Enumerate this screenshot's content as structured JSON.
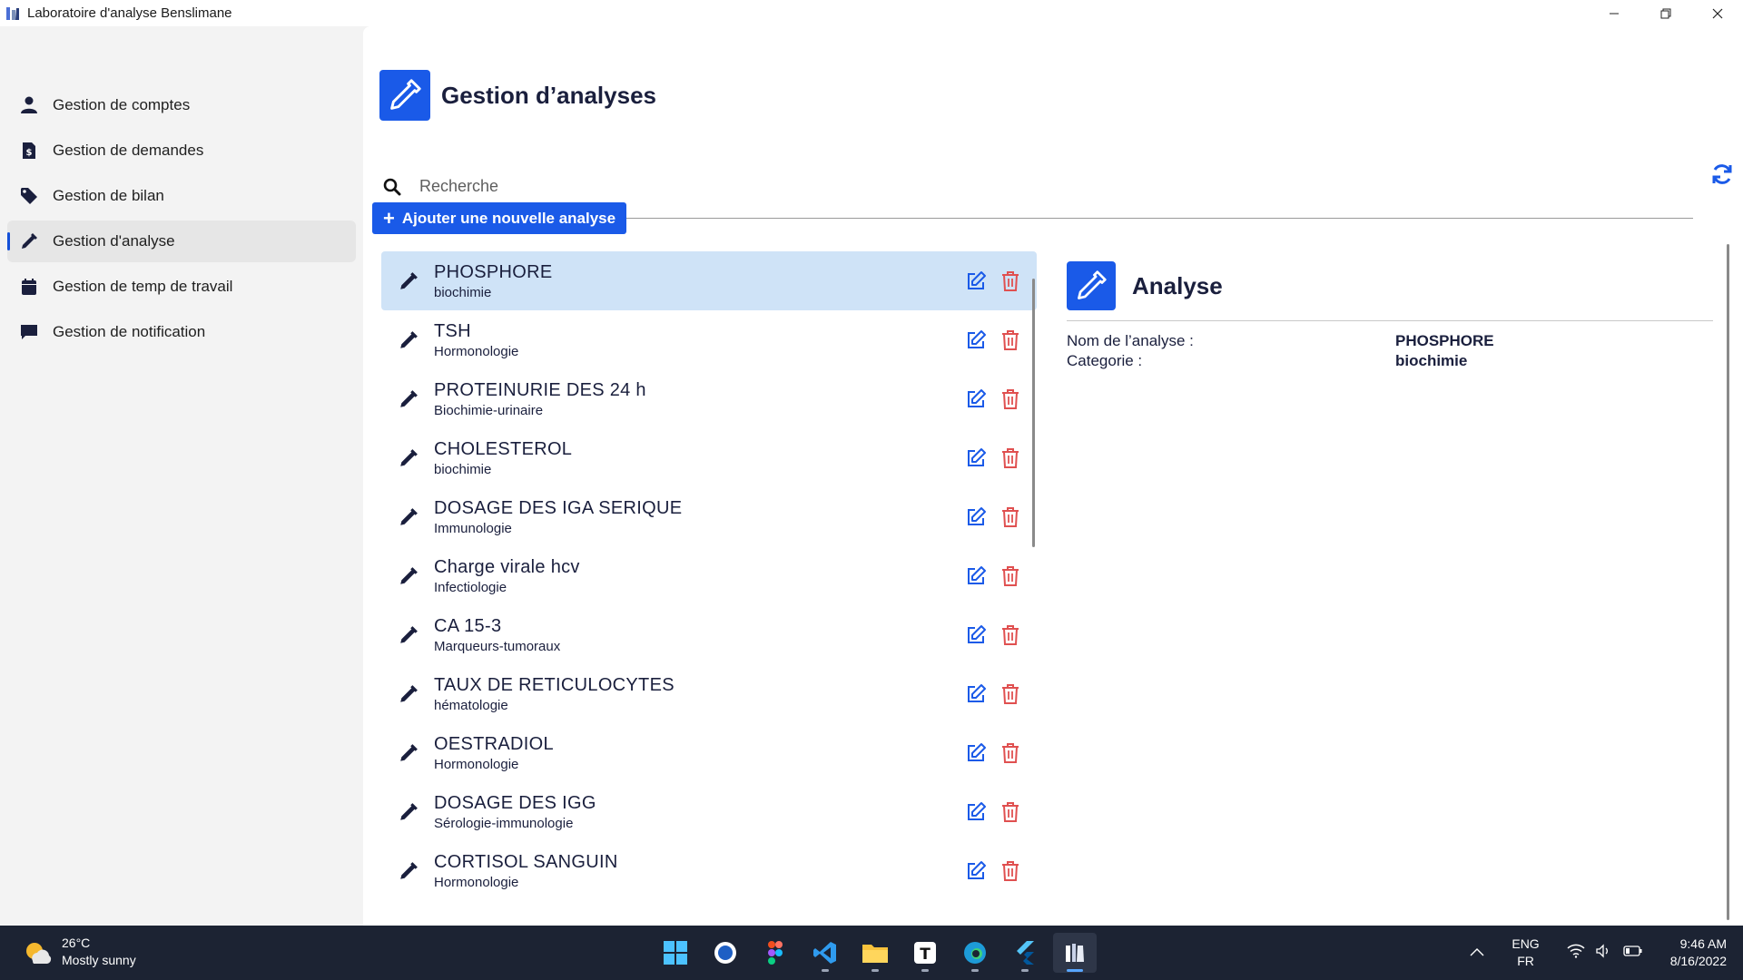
{
  "window": {
    "title": "Laboratoire d'analyse Benslimane"
  },
  "sidebar": {
    "items": [
      {
        "label": "Gestion de comptes",
        "icon": "user-icon"
      },
      {
        "label": "Gestion de demandes",
        "icon": "invoice-icon"
      },
      {
        "label": "Gestion de bilan",
        "icon": "tag-icon"
      },
      {
        "label": "Gestion d'analyse",
        "icon": "pipette-icon",
        "active": true
      },
      {
        "label": "Gestion de temp de travail",
        "icon": "calendar-icon"
      },
      {
        "label": "Gestion de notification",
        "icon": "message-icon"
      }
    ]
  },
  "header": {
    "title": "Gestion d’analyses"
  },
  "search": {
    "placeholder": "Recherche",
    "value": ""
  },
  "toolbar": {
    "add_label": "Ajouter  une nouvelle analyse"
  },
  "analyses": [
    {
      "name": "PHOSPHORE",
      "category": "biochimie"
    },
    {
      "name": "TSH",
      "category": "Hormonologie"
    },
    {
      "name": "PROTEINURIE DES 24 h",
      "category": "Biochimie-urinaire"
    },
    {
      "name": "CHOLESTEROL",
      "category": "biochimie"
    },
    {
      "name": "DOSAGE DES IGA SERIQUE",
      "category": "Immunologie"
    },
    {
      "name": "Charge virale hcv",
      "category": "Infectiologie"
    },
    {
      "name": "CA 15-3",
      "category": "Marqueurs-tumoraux"
    },
    {
      "name": "TAUX DE RETICULOCYTES",
      "category": "hématologie"
    },
    {
      "name": "OESTRADIOL",
      "category": "Hormonologie"
    },
    {
      "name": "DOSAGE DES IGG",
      "category": "Sérologie-immunologie"
    },
    {
      "name": "CORTISOL SANGUIN",
      "category": "Hormonologie"
    }
  ],
  "detail": {
    "title": "Analyse",
    "name_label": "Nom de l’analyse :",
    "name_value": "PHOSPHORE",
    "category_label": "Categorie :",
    "category_value": "biochimie"
  },
  "taskbar": {
    "weather_temp": "26°C",
    "weather_text": "Mostly sunny",
    "lang_top": "ENG",
    "lang_bottom": "FR",
    "time": "9:46 AM",
    "date": "8/16/2022",
    "apps": [
      "start-icon",
      "dolphin-icon",
      "figma-icon",
      "vscode-icon",
      "file-explorer-icon",
      "typora-icon",
      "edge-icon",
      "flutter-icon",
      "lab-app-icon"
    ]
  },
  "colors": {
    "accent": "#1a5ae8",
    "selected_row": "#cfe3f7",
    "delete": "#e05050",
    "text_dark": "#1a1f3d",
    "taskbar": "#1c2333"
  }
}
